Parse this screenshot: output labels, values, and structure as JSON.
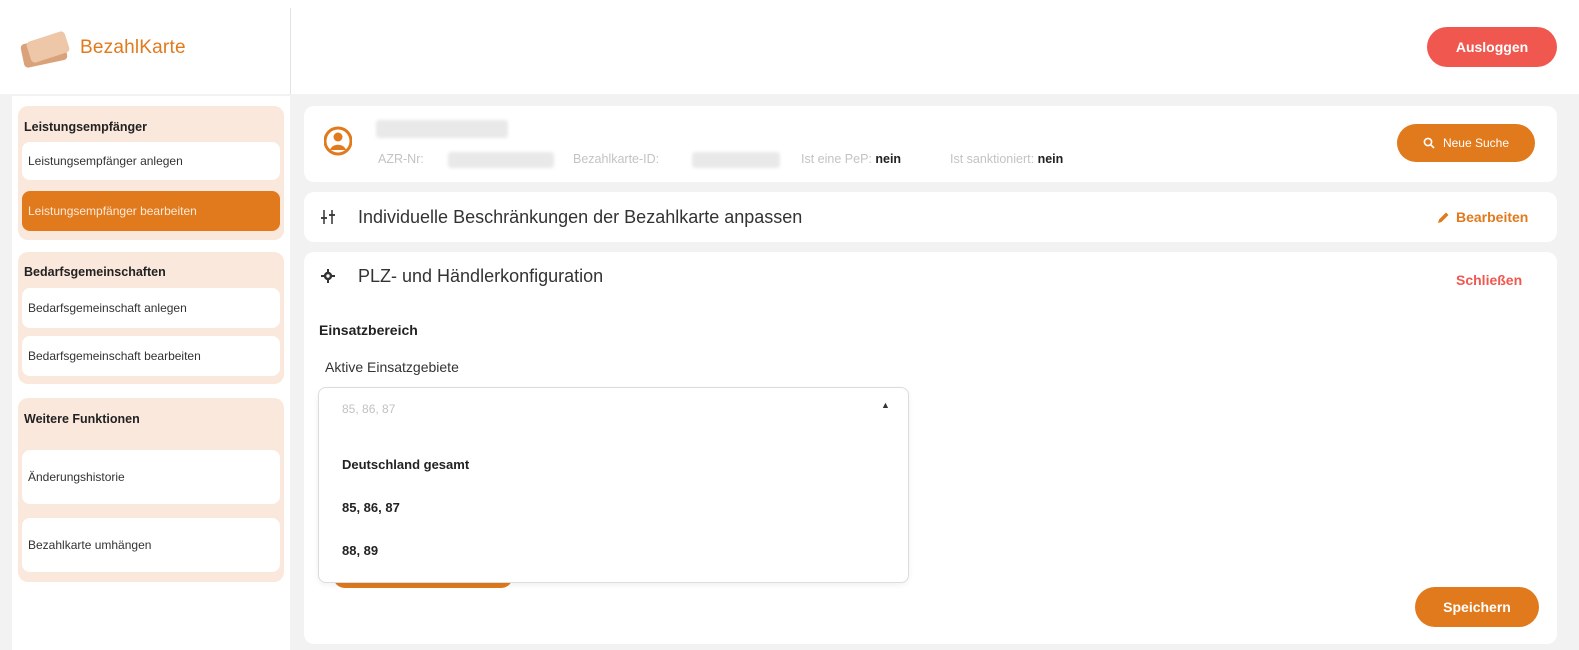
{
  "brand": {
    "name": "BezahlKarte"
  },
  "header": {
    "logout_label": "Ausloggen"
  },
  "sidebar": {
    "groups": [
      {
        "title": "Leistungsempfänger",
        "items": [
          {
            "label": "Leistungsempfänger anlegen",
            "active": false
          },
          {
            "label": "Leistungsempfänger bearbeiten",
            "active": true
          }
        ]
      },
      {
        "title": "Bedarfsgemeinschaften",
        "items": [
          {
            "label": "Bedarfsgemeinschaft anlegen",
            "active": false
          },
          {
            "label": "Bedarfsgemeinschaft bearbeiten",
            "active": false
          }
        ]
      },
      {
        "title": "Weitere Funktionen",
        "items": [
          {
            "label": "Änderungshistorie",
            "active": false
          },
          {
            "label": "Bezahlkarte umhängen",
            "active": false
          }
        ]
      }
    ]
  },
  "person": {
    "azr_label": "AZR-Nr:",
    "card_id_label": "Bezahlkarte-ID:",
    "pep_label": "Ist eine PeP:",
    "pep_value": "nein",
    "sanction_label": "Ist sanktioniert:",
    "sanction_value": "nein",
    "new_search_label": "Neue Suche"
  },
  "restrictions": {
    "title": "Individuelle Beschränkungen der Bezahlkarte anpassen",
    "edit_label": "Bearbeiten"
  },
  "plz_config": {
    "title": "PLZ- und Händlerkonfiguration",
    "close_label": "Schließen",
    "section_label": "Einsatzbereich",
    "field_label": "Aktive Einsatzgebiete",
    "selected_value": "85, 86, 87",
    "options": [
      "Deutschland gesamt",
      "85, 86, 87",
      "88, 89"
    ],
    "save_label": "Speichern"
  },
  "colors": {
    "accent": "#e17a1d",
    "danger": "#f0584f",
    "sidebar_group_bg": "#fbe8dc"
  }
}
